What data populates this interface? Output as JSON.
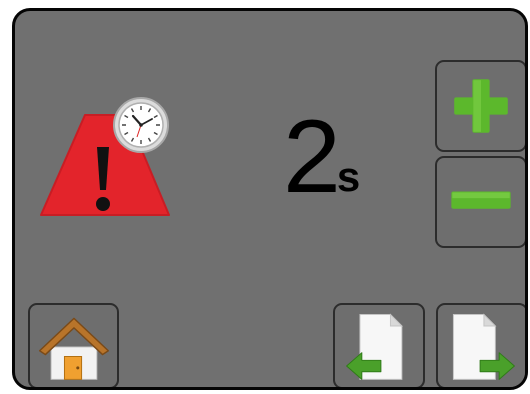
{
  "display": {
    "value": "2",
    "unit": "s"
  },
  "icons": {
    "warning": "warning-triangle-with-clock-icon",
    "increase": "plus-icon",
    "decrease": "minus-icon",
    "home": "home-icon",
    "previous": "previous-page-icon",
    "next": "next-page-icon"
  },
  "colors": {
    "screen_background": "#707070",
    "warning_red": "#e3242b",
    "button_green": "#5cb82c",
    "house_orange": "#f0a030"
  }
}
